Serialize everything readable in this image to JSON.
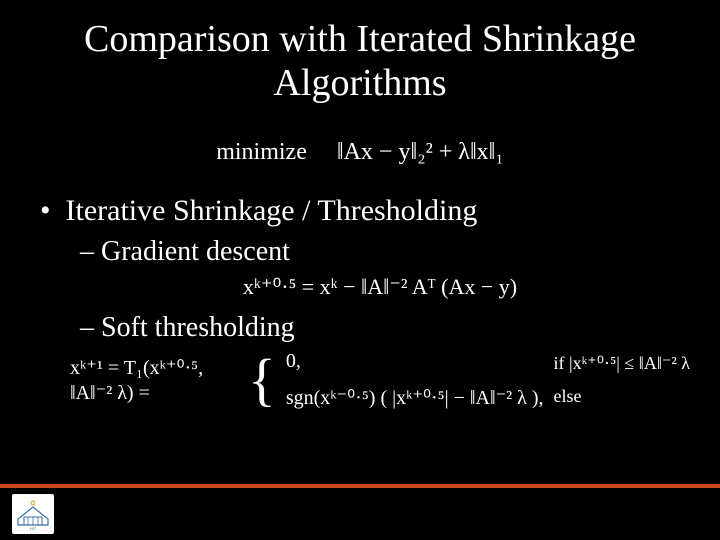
{
  "title": "Comparison with Iterated Shrinkage Algorithms",
  "objective_label": "minimize",
  "objective_expr": "‖Ax − y‖₂² + λ‖x‖₁",
  "bullet1": "Iterative Shrinkage / Thresholding",
  "sub1": "Gradient descent",
  "gd_expr": "xᵏ⁺⁰·⁵ = xᵏ − ‖A‖⁻² Aᵀ (Ax − y)",
  "sub2": "Soft thresholding",
  "soft_lhs": "xᵏ⁺¹ = T₁(xᵏ⁺⁰·⁵, ‖A‖⁻² λ) =",
  "case1_val": "0,",
  "case1_cond": "if |xᵏ⁺⁰·⁵| ≤ ‖A‖⁻² λ",
  "case2_val": "sgn(xᵏ⁻⁰·⁵) ( |xᵏ⁺⁰·⁵| − ‖A‖⁻² λ ),",
  "case2_cond": "else",
  "logo_label": "HIT"
}
